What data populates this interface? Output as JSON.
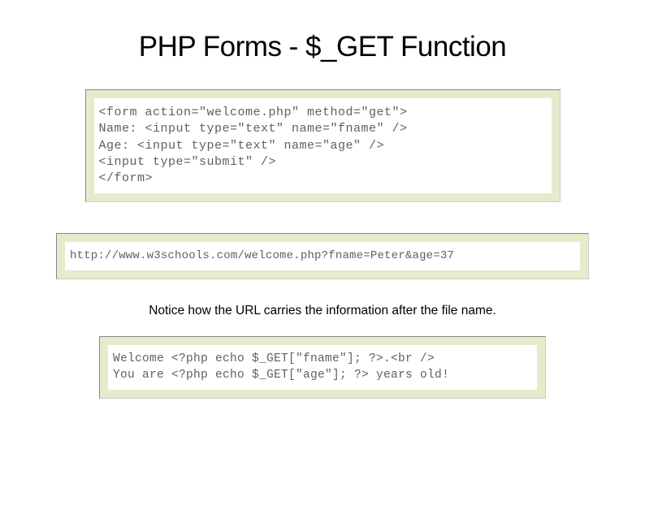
{
  "title": "PHP Forms - $_GET Function",
  "codeBlock1": "<form action=\"welcome.php\" method=\"get\">\nName: <input type=\"text\" name=\"fname\" />\nAge: <input type=\"text\" name=\"age\" />\n<input type=\"submit\" />\n</form>",
  "codeBlock2": "http://www.w3schools.com/welcome.php?fname=Peter&age=37",
  "noticeText": "Notice how the URL carries the information after the file name.",
  "codeBlock3": "Welcome <?php echo $_GET[\"fname\"]; ?>.<br />\nYou are <?php echo $_GET[\"age\"]; ?> years old!"
}
